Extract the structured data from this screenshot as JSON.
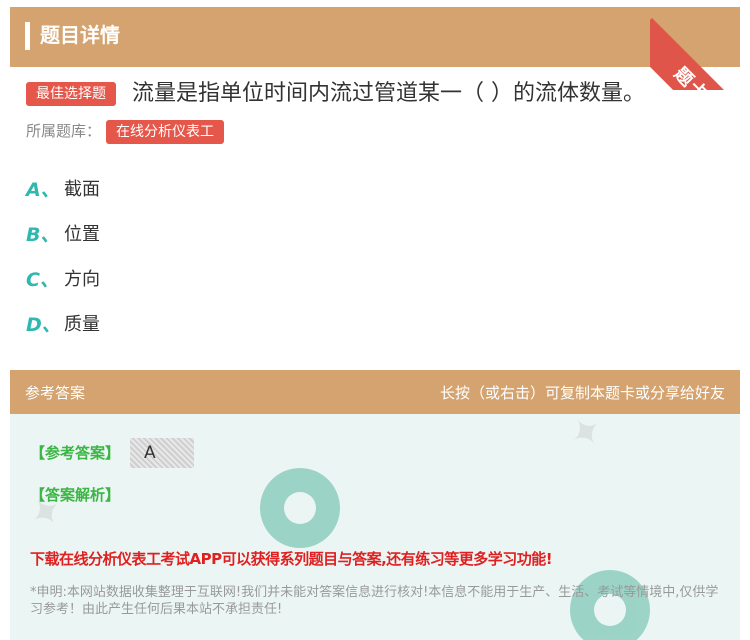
{
  "header": {
    "title": "题目详情"
  },
  "ribbon": {
    "label": "题卡"
  },
  "question": {
    "badge": "最佳选择题",
    "text": "流量是指单位时间内流过管道某一（ ）的流体数量。",
    "bank_label": "所属题库：",
    "bank_name": "在线分析仪表工"
  },
  "options": [
    {
      "letter": "A、",
      "text": "截面"
    },
    {
      "letter": "B、",
      "text": "位置"
    },
    {
      "letter": "C、",
      "text": "方向"
    },
    {
      "letter": "D、",
      "text": "质量"
    }
  ],
  "answer": {
    "header_left": "参考答案",
    "header_right": "长按（或右击）可复制本题卡或分享给好友",
    "ref_label": "【参考答案】",
    "ref_value": "A",
    "analysis_label": "【答案解析】",
    "promo": "下载在线分析仪表工考试APP可以获得系列题目与答案,还有练习等更多学习功能!",
    "disclaimer": "*申明:本网站数据收集整理于互联网!我们并未能对答案信息进行核对!本信息不能用于生产、生活、考试等情境中,仅供学习参考！由此产生任何后果本站不承担责任!"
  },
  "colors": {
    "header_bg": "#d4a36f",
    "badge_red": "#e4574a",
    "option_letter": "#2fb8b0",
    "answer_green": "#3bb543",
    "promo_red": "#e02020"
  }
}
